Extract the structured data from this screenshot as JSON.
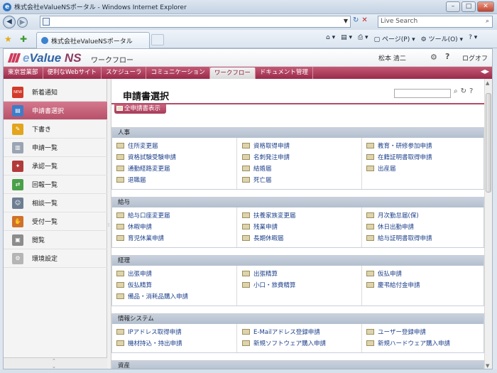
{
  "browser": {
    "title": "株式会社eValueNSポータル - Windows Internet Explorer",
    "search_placeholder": "Live Search",
    "tab_label": "株式会社eValueNSポータル",
    "page_menu": "ページ(P)",
    "tools_menu": "ツール(O)"
  },
  "header": {
    "logo_e": "e",
    "logo_value": "Value",
    "logo_ns": " NS",
    "subtitle": "ワークフロー",
    "user": "松本 清二",
    "logout": "ログオフ"
  },
  "nav": [
    "東京営業部",
    "便利なWebサイト",
    "スケジューラ",
    "コミュニケーション",
    "ワークフロー",
    "ドキュメント管理"
  ],
  "nav_active": 4,
  "sidebar": [
    {
      "label": "新着通知",
      "icon": "new-icon",
      "color": "#d23a2a"
    },
    {
      "label": "申請書選択",
      "icon": "form-select-icon",
      "color": "#3e7cc7"
    },
    {
      "label": "下書き",
      "icon": "pencil-icon",
      "color": "#e3a51d"
    },
    {
      "label": "申請一覧",
      "icon": "documents-icon",
      "color": "#9aa4b2"
    },
    {
      "label": "承認一覧",
      "icon": "stamp-icon",
      "color": "#b23a3a"
    },
    {
      "label": "回報一覧",
      "icon": "circulation-icon",
      "color": "#4aa04a"
    },
    {
      "label": "相談一覧",
      "icon": "people-icon",
      "color": "#6d7d92"
    },
    {
      "label": "受付一覧",
      "icon": "hand-icon",
      "color": "#d0702c"
    },
    {
      "label": "閲覧",
      "icon": "view-icon",
      "color": "#8c8c8c"
    },
    {
      "label": "環境設定",
      "icon": "gear-icon",
      "color": "#b5b5b5"
    }
  ],
  "sidebar_active": 1,
  "content": {
    "title": "申請書選択",
    "all_button": "全申請書表示"
  },
  "categories": [
    {
      "name": "人事",
      "rows": [
        [
          "住所変更届",
          "資格取得申請",
          "教育・研修参加申請"
        ],
        [
          "資格試験受験申請",
          "名刺発注申請",
          "在籍証明書取得申請"
        ],
        [
          "通勤経路変更届",
          "結婚届",
          "出産届"
        ],
        [
          "退職届",
          "死亡届",
          ""
        ]
      ]
    },
    {
      "name": "給与",
      "rows": [
        [
          "給与口座変更届",
          "扶養家族変更届",
          "月次勤怠届(保)"
        ],
        [
          "休暇申請",
          "残業申請",
          "休日出勤申請"
        ],
        [
          "育児休業申請",
          "長期休暇届",
          "給与証明書取得申請"
        ]
      ]
    },
    {
      "name": "経理",
      "rows": [
        [
          "出張申請",
          "出張精算",
          "仮払申請"
        ],
        [
          "仮払精算",
          "小口・旅費精算",
          "慶弔給付金申請"
        ],
        [
          "備品・消耗品購入申請",
          "",
          ""
        ]
      ]
    },
    {
      "name": "情報システム",
      "rows": [
        [
          "IPアドレス取得申請",
          "E-Mailアドレス登録申請",
          "ユーザー登録申請"
        ],
        [
          "機材持込・持出申請",
          "新規ソフトウェア購入申請",
          "新規ハードウェア購入申請"
        ]
      ]
    },
    {
      "name": "資産",
      "rows": []
    }
  ]
}
